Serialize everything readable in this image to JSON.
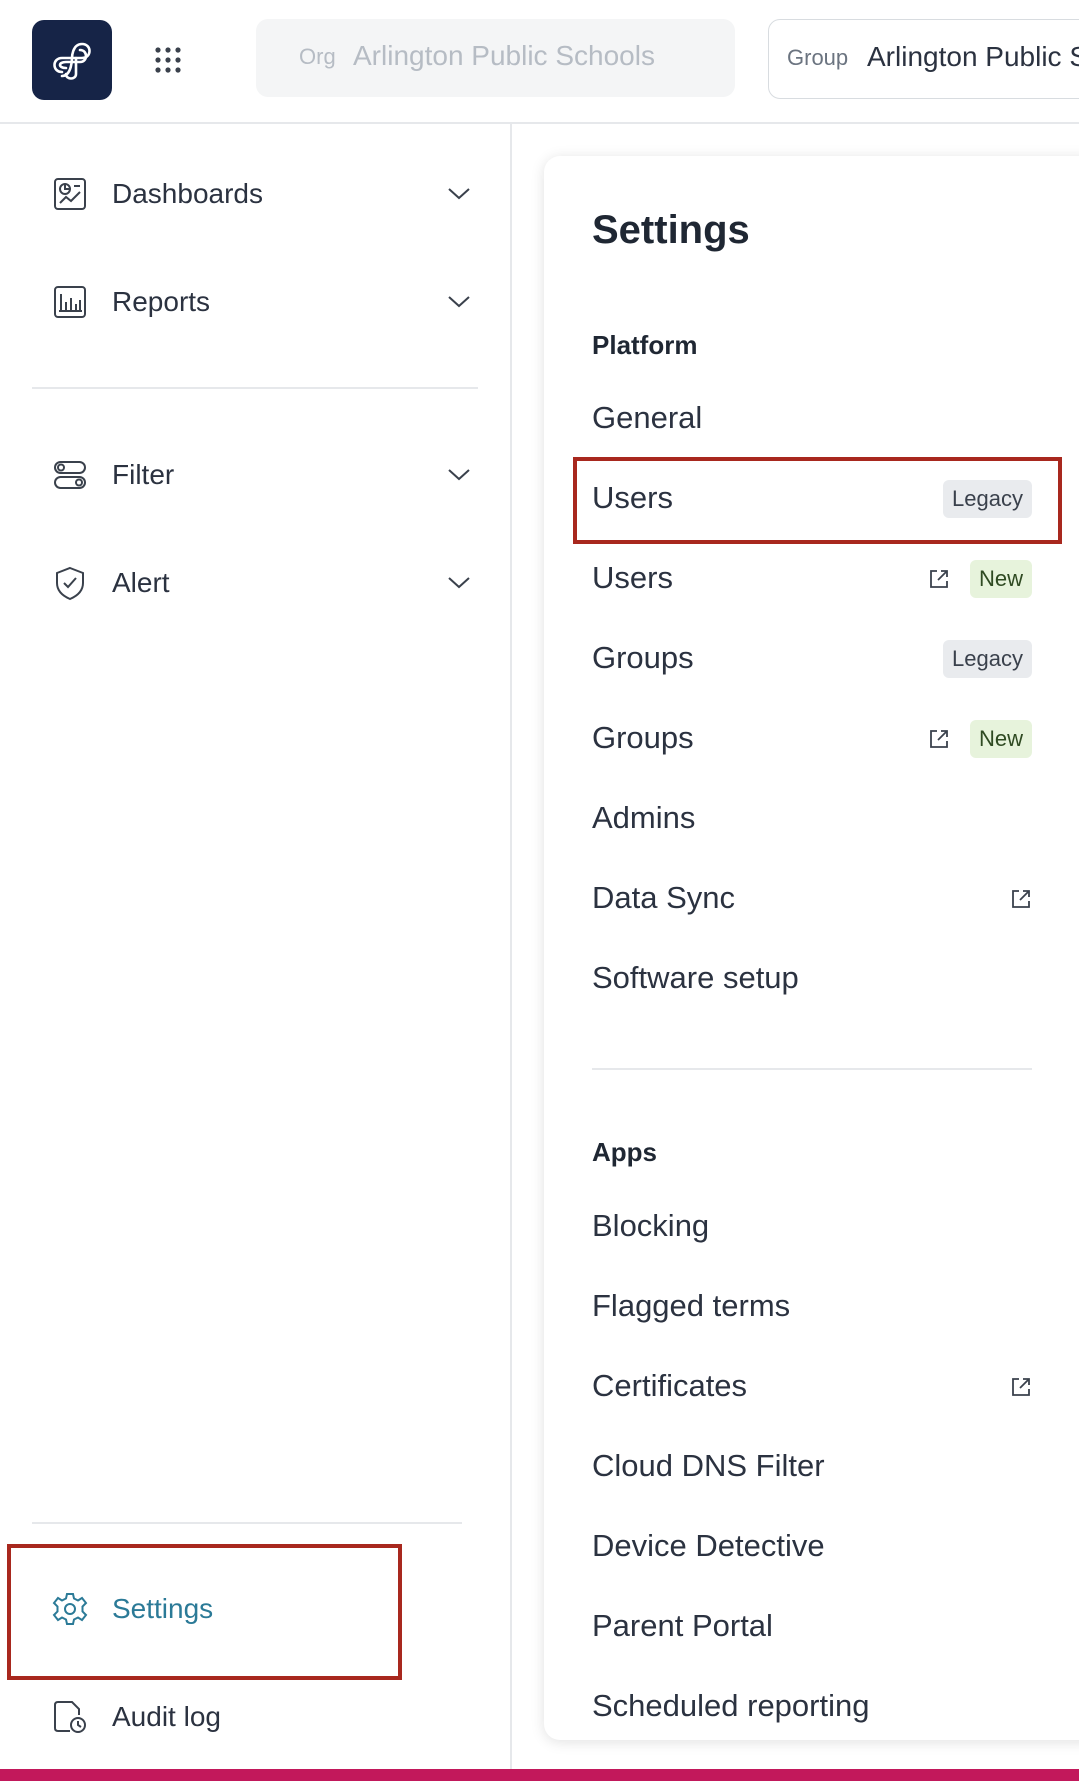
{
  "header": {
    "org_label": "Org",
    "org_value": "Arlington Public Schools",
    "group_label": "Group",
    "group_value": "Arlington Public S"
  },
  "sidebar": {
    "items": [
      {
        "label": "Dashboards",
        "icon": "dashboard-icon"
      },
      {
        "label": "Reports",
        "icon": "reports-icon"
      },
      {
        "label": "Filter",
        "icon": "filter-icon"
      },
      {
        "label": "Alert",
        "icon": "alert-shield-icon"
      }
    ],
    "bottom": [
      {
        "label": "Settings",
        "icon": "gear-icon",
        "active": true
      },
      {
        "label": "Audit log",
        "icon": "audit-log-icon"
      }
    ]
  },
  "settings": {
    "title": "Settings",
    "platform": {
      "title": "Platform",
      "items": [
        {
          "label": "General"
        },
        {
          "label": "Users",
          "badge": "Legacy"
        },
        {
          "label": "Users",
          "badge": "New",
          "external": true
        },
        {
          "label": "Groups",
          "badge": "Legacy"
        },
        {
          "label": "Groups",
          "badge": "New",
          "external": true
        },
        {
          "label": "Admins"
        },
        {
          "label": "Data Sync",
          "external": true
        },
        {
          "label": "Software setup"
        }
      ]
    },
    "apps": {
      "title": "Apps",
      "items": [
        {
          "label": "Blocking"
        },
        {
          "label": "Flagged terms"
        },
        {
          "label": "Certificates",
          "external": true
        },
        {
          "label": "Cloud DNS Filter"
        },
        {
          "label": "Device Detective"
        },
        {
          "label": "Parent Portal"
        },
        {
          "label": "Scheduled reporting"
        }
      ]
    }
  },
  "colors": {
    "brand": "#162447",
    "active": "#2b7a97",
    "highlight": "#a8281e"
  }
}
